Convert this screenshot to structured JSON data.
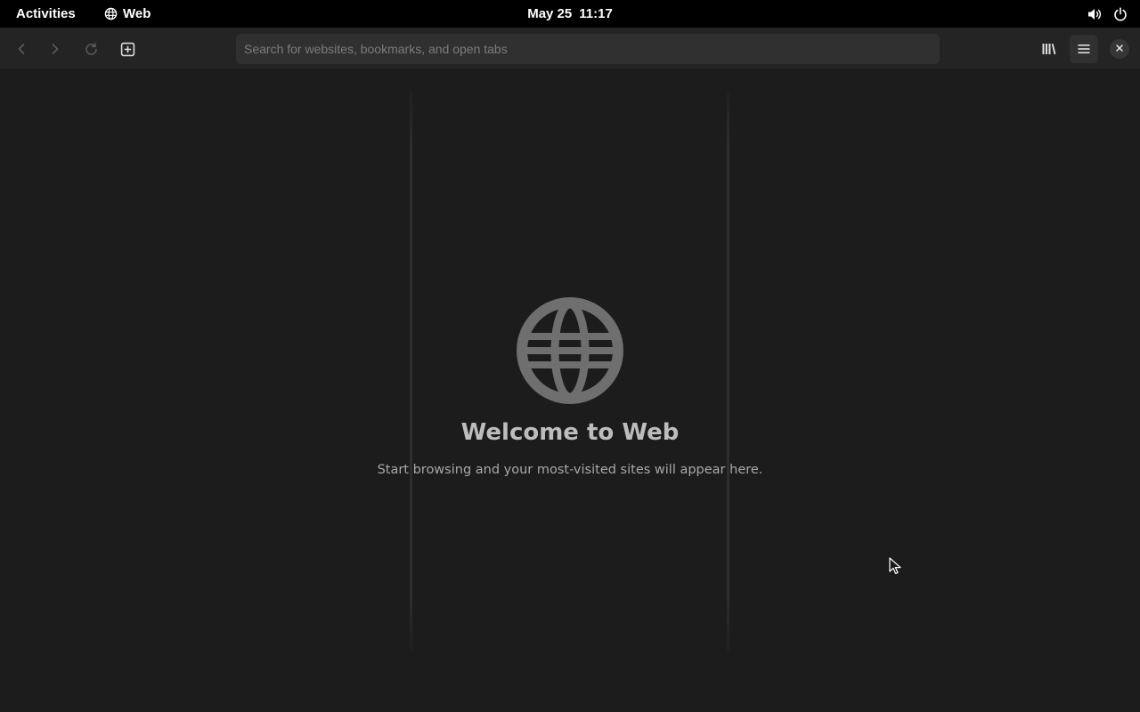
{
  "topbar": {
    "activities_label": "Activities",
    "app_name": "Web",
    "app_icon": "globe-icon",
    "date": "May 25",
    "time": "11:17",
    "tray_icons": [
      "volume-icon",
      "power-icon"
    ]
  },
  "headerbar": {
    "back_icon": "back-arrow-icon",
    "forward_icon": "forward-arrow-icon",
    "reload_icon": "reload-icon",
    "new_tab_icon": "new-tab-icon",
    "search_placeholder": "Search for websites, bookmarks, and open tabs",
    "search_value": "",
    "library_icon": "library-icon",
    "menu_icon": "hamburger-menu-icon",
    "close_icon": "close-icon"
  },
  "content": {
    "welcome_icon": "globe-icon",
    "title": "Welcome to Web",
    "subtitle": "Start browsing and your most-visited sites will appear here."
  },
  "colors": {
    "topbar_bg": "#000000",
    "headerbar_bg": "#242424",
    "content_bg": "#1c1c1c",
    "urlbar_bg": "#303030",
    "welcome_icon_color": "#6f6f6f",
    "title_color": "#bdbdbd"
  }
}
